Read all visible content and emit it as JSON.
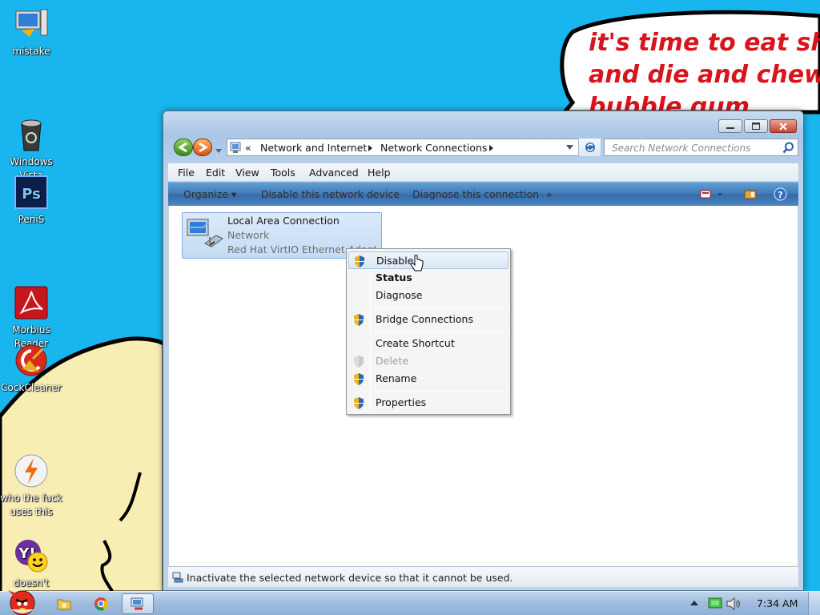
{
  "wallpaper": {
    "speech_lines": [
      "it's time to eat shit",
      "and die and chew",
      "bubble gum"
    ],
    "colors": {
      "background": "#19b5ee",
      "speech_text": "#d8141c",
      "character": "#f8eeb4"
    }
  },
  "desktop_icons": [
    {
      "name": "mistake",
      "label": "mistake",
      "icon": "computer-icon"
    },
    {
      "name": "windows-vista",
      "label": "Windows\nVista",
      "icon": "recycle-bin-icon"
    },
    {
      "name": "penis",
      "label": "PeniS",
      "icon": "photoshop-icon"
    },
    {
      "name": "morbius-reader",
      "label": "Morbius\nReader",
      "icon": "pdf-reader-icon"
    },
    {
      "name": "cockcleaner",
      "label": "CockCleaner",
      "icon": "broom-icon"
    },
    {
      "name": "who-the-fuck-uses-this",
      "label": "who the fuck\nuses this",
      "icon": "lightning-icon"
    },
    {
      "name": "doesnt-work-lol",
      "label": "doesn't\nwork lol",
      "icon": "yahoo-messenger-icon"
    }
  ],
  "window": {
    "address": {
      "chevron": "«",
      "crumbs": [
        "Network and Internet",
        "Network Connections"
      ]
    },
    "search_placeholder": "Search Network Connections",
    "menu": [
      "File",
      "Edit",
      "View",
      "Tools",
      "Advanced",
      "Help"
    ],
    "commands": {
      "organize": "Organize",
      "disable": "Disable this network device",
      "diagnose": "Diagnose this connection",
      "more": "»"
    },
    "connection": {
      "name": "Local Area Connection",
      "network": "Network",
      "adapter": "Red Hat VirtIO Ethernet Adapter"
    },
    "status": "Inactivate the selected network device so that it cannot be used."
  },
  "context_menu": {
    "items": [
      {
        "label": "Disable",
        "shield": true,
        "highlighted": true
      },
      {
        "label": "Status",
        "bold": true
      },
      {
        "label": "Diagnose"
      },
      {
        "label": "Bridge Connections",
        "shield": true
      },
      {
        "label": "Create Shortcut"
      },
      {
        "label": "Delete",
        "disabled": true,
        "shield": true
      },
      {
        "label": "Rename",
        "shield": true
      },
      {
        "label": "Properties",
        "shield": true
      }
    ]
  },
  "taskbar": {
    "clock": "7:34 AM",
    "pinned": [
      "start-orb-angry-bird-icon",
      "explorer-folder-icon",
      "chrome-icon",
      "network-connections-icon"
    ]
  }
}
